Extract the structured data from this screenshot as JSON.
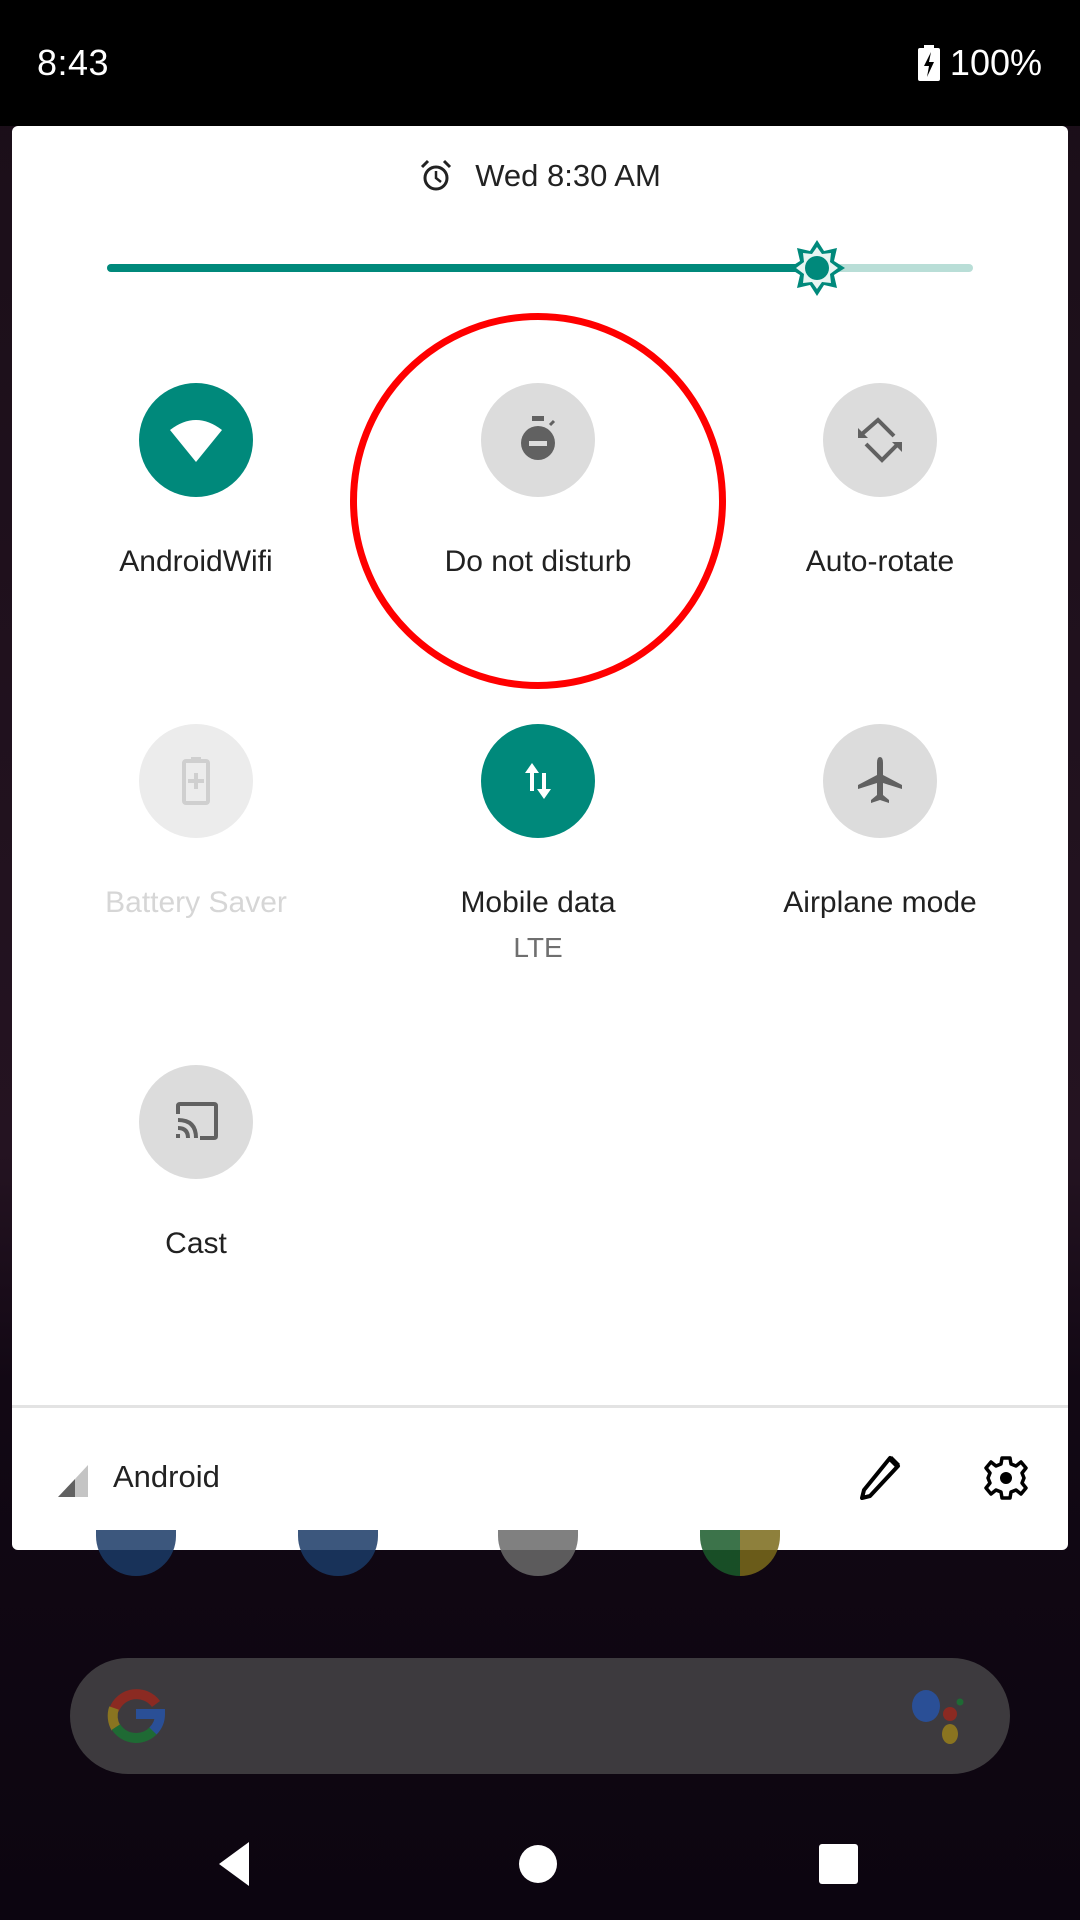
{
  "status_bar": {
    "time": "8:43",
    "battery_icon": "battery-charging-icon",
    "battery_percent": "100%"
  },
  "quick_settings": {
    "alarm": {
      "icon": "alarm-clock-icon",
      "text": "Wed 8:30 AM"
    },
    "brightness": {
      "icon": "brightness-sun-icon",
      "level": 0.82,
      "accent_color": "#00897b",
      "track_color": "#b9ded7"
    },
    "tiles": [
      {
        "label": "AndroidWifi",
        "icon": "wifi-icon",
        "state": "on"
      },
      {
        "label": "Do not disturb",
        "icon": "do-not-disturb-icon",
        "state": "off"
      },
      {
        "label": "Auto-rotate",
        "icon": "auto-rotate-icon",
        "state": "off"
      },
      {
        "label": "Battery Saver",
        "icon": "battery-saver-icon",
        "state": "disabled"
      },
      {
        "label": "Mobile data",
        "sublabel": "LTE",
        "icon": "mobile-data-icon",
        "state": "on"
      },
      {
        "label": "Airplane mode",
        "icon": "airplane-icon",
        "state": "off"
      },
      {
        "label": "Cast",
        "icon": "cast-icon",
        "state": "off"
      }
    ],
    "footer": {
      "signal_icon": "cell-signal-icon",
      "carrier": "Android",
      "edit_icon": "pencil-icon",
      "settings_icon": "gear-icon"
    }
  },
  "home": {
    "search_bar": {
      "logo": "google-g-icon",
      "assistant": "google-assistant-icon"
    }
  },
  "navigation": {
    "back": "back-icon",
    "home": "home-icon",
    "recents": "recents-icon"
  },
  "annotation": {
    "target": "Do not disturb",
    "color": "#ff0000"
  }
}
